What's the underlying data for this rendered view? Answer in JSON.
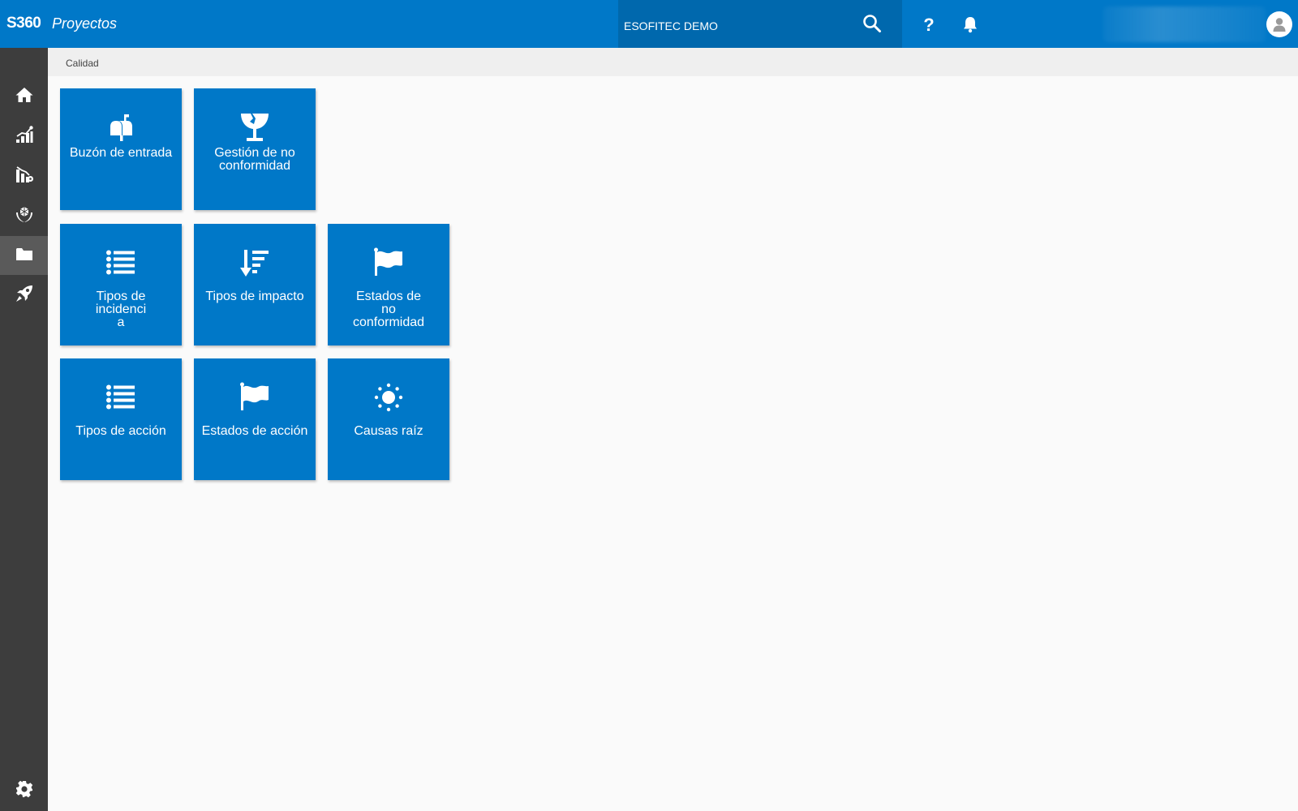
{
  "header": {
    "brand": "S360",
    "app_title": "Proyectos",
    "company": "ESOFITEC DEMO",
    "icons": [
      "search-icon",
      "help-icon",
      "bell-icon",
      "user-icon"
    ]
  },
  "sidebar": {
    "items": [
      {
        "name": "home",
        "icon": "home-icon"
      },
      {
        "name": "analytics",
        "icon": "chart-icon"
      },
      {
        "name": "reports",
        "icon": "report-chart-icon"
      },
      {
        "name": "care",
        "icon": "hands-heart-icon"
      },
      {
        "name": "projects",
        "icon": "folder-icon",
        "active": true
      },
      {
        "name": "launch",
        "icon": "rocket-icon"
      }
    ],
    "settings_icon": "gear-icon"
  },
  "breadcrumb": {
    "current": "Calidad"
  },
  "tiles": [
    {
      "label": "Buzón de entrada",
      "icon": "mailbox-icon"
    },
    {
      "label": "Gestión de no\nconformidad",
      "icon": "broken-glass-icon"
    },
    {
      "label": "Tipos de\nincidenci\na",
      "icon": "list-icon"
    },
    {
      "label": "Tipos de impacto",
      "icon": "sort-down-icon"
    },
    {
      "label": "Estados de\nno\nconformidad",
      "icon": "flag-icon"
    },
    {
      "label": "Tipos de acción",
      "icon": "list-icon"
    },
    {
      "label": "Estados de acción",
      "icon": "flag-icon"
    },
    {
      "label": "Causas raíz",
      "icon": "sun-icon"
    }
  ],
  "colors": {
    "primary": "#0078c8",
    "search_bg": "#0068ad",
    "sidebar_bg": "#3d3d3d",
    "sidebar_active": "#5a5a5a",
    "breadcrumb_bg": "#efefef",
    "page_bg": "#fafafa"
  }
}
